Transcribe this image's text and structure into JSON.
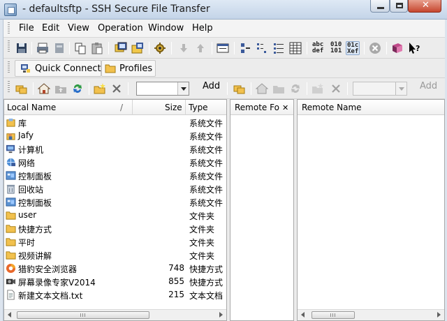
{
  "window": {
    "title": "- defaultsftp - SSH Secure File Transfer"
  },
  "menu": [
    "File",
    "Edit",
    "View",
    "Operation",
    "Window",
    "Help"
  ],
  "toolbar2": {
    "quick_connect": "Quick Connect",
    "profiles": "Profiles"
  },
  "toolbar3": {
    "add_local": "Add",
    "add_remote": "Add"
  },
  "toolbar_text": {
    "abc_top": "abc",
    "abc_bot": "def",
    "bin_top": "010",
    "bin_bot": "101",
    "auto_top": "01c",
    "auto_bot": "Xef"
  },
  "local": {
    "headers": {
      "name": "Local Name",
      "sort": "/",
      "size": "Size",
      "type": "Type"
    },
    "rows": [
      {
        "name": "库",
        "size": "",
        "type": "系统文件",
        "icon": "library-icon"
      },
      {
        "name": "Jafy",
        "size": "",
        "type": "系统文件",
        "icon": "user-folder-icon"
      },
      {
        "name": "计算机",
        "size": "",
        "type": "系统文件",
        "icon": "computer-icon"
      },
      {
        "name": "网络",
        "size": "",
        "type": "系统文件",
        "icon": "network-icon"
      },
      {
        "name": "控制面板",
        "size": "",
        "type": "系统文件",
        "icon": "control-panel-icon"
      },
      {
        "name": "回收站",
        "size": "",
        "type": "系统文件",
        "icon": "recycle-bin-icon"
      },
      {
        "name": "控制面板",
        "size": "",
        "type": "系统文件",
        "icon": "control-panel-icon"
      },
      {
        "name": "user",
        "size": "",
        "type": "文件夹",
        "icon": "folder-icon"
      },
      {
        "name": "快捷方式",
        "size": "",
        "type": "文件夹",
        "icon": "folder-icon"
      },
      {
        "name": "平时",
        "size": "",
        "type": "文件夹",
        "icon": "folder-icon"
      },
      {
        "name": "视频讲解",
        "size": "",
        "type": "文件夹",
        "icon": "folder-icon"
      },
      {
        "name": "猎豹安全浏览器",
        "size": "748",
        "type": "快捷方式",
        "icon": "browser-icon"
      },
      {
        "name": "屏幕录像专家V2014",
        "size": "855",
        "type": "快捷方式",
        "icon": "screen-recorder-icon"
      },
      {
        "name": "新建文本文档.txt",
        "size": "215",
        "type": "文本文档",
        "icon": "text-file-icon"
      }
    ]
  },
  "middle": {
    "tab_label": "Remote Fo",
    "close": "✕"
  },
  "remote": {
    "headers": {
      "name": "Remote Name"
    }
  },
  "colors": {
    "folder": "#f2c14e",
    "accent": "#2a6fc9",
    "title_bar": "#c4d4e8"
  }
}
